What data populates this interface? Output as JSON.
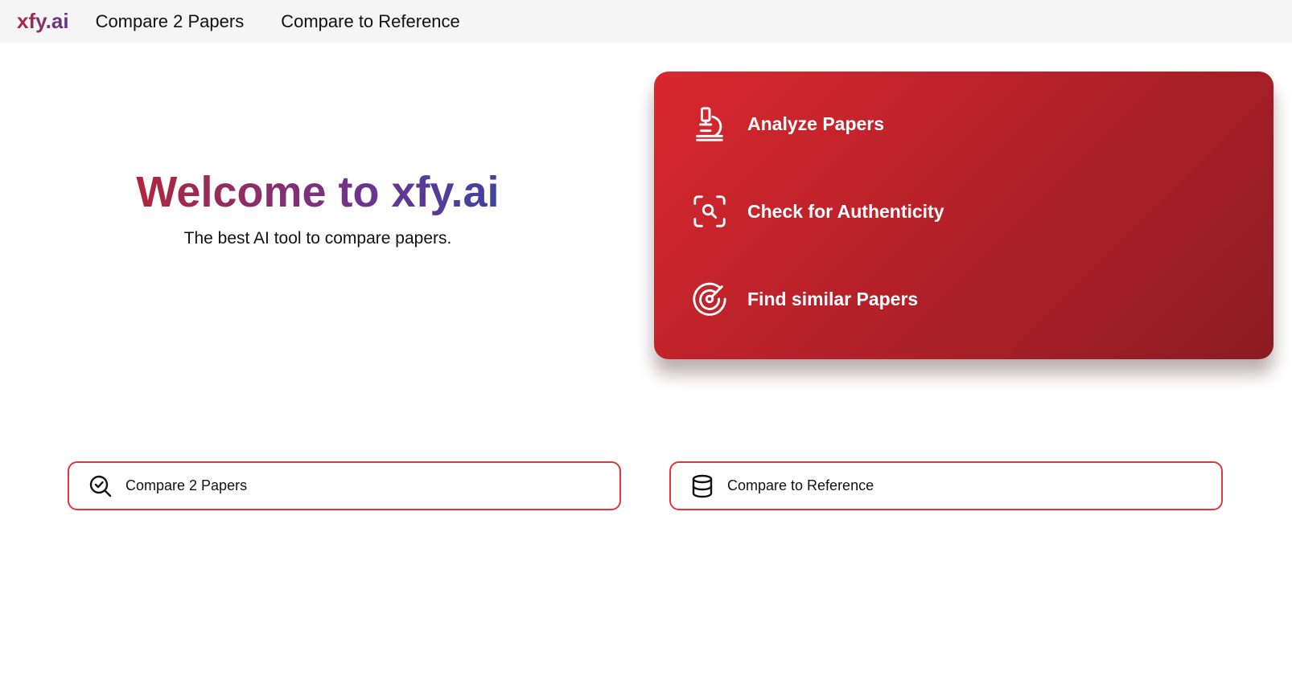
{
  "nav": {
    "brand": "xfy.ai",
    "links": [
      {
        "label": "Compare 2 Papers"
      },
      {
        "label": "Compare to Reference"
      }
    ]
  },
  "hero": {
    "title": "Welcome to xfy.ai",
    "subtitle": "The best AI tool to compare papers."
  },
  "feature_card": {
    "items": [
      {
        "label": "Analyze Papers",
        "icon": "microscope-icon"
      },
      {
        "label": "Check for Authenticity",
        "icon": "scan-search-icon"
      },
      {
        "label": "Find similar Papers",
        "icon": "radar-icon"
      }
    ]
  },
  "actions": [
    {
      "label": "Compare 2 Papers",
      "icon": "search-check-icon"
    },
    {
      "label": "Compare to Reference",
      "icon": "database-icon"
    }
  ],
  "colors": {
    "accent_red": "#e0363c",
    "card_gradient_start": "#d9282e",
    "card_gradient_end": "#8b1c22",
    "brand_gradient_start": "#b0263d",
    "brand_gradient_end": "#3f43a0",
    "topbar_bg": "#f5f5f5"
  }
}
